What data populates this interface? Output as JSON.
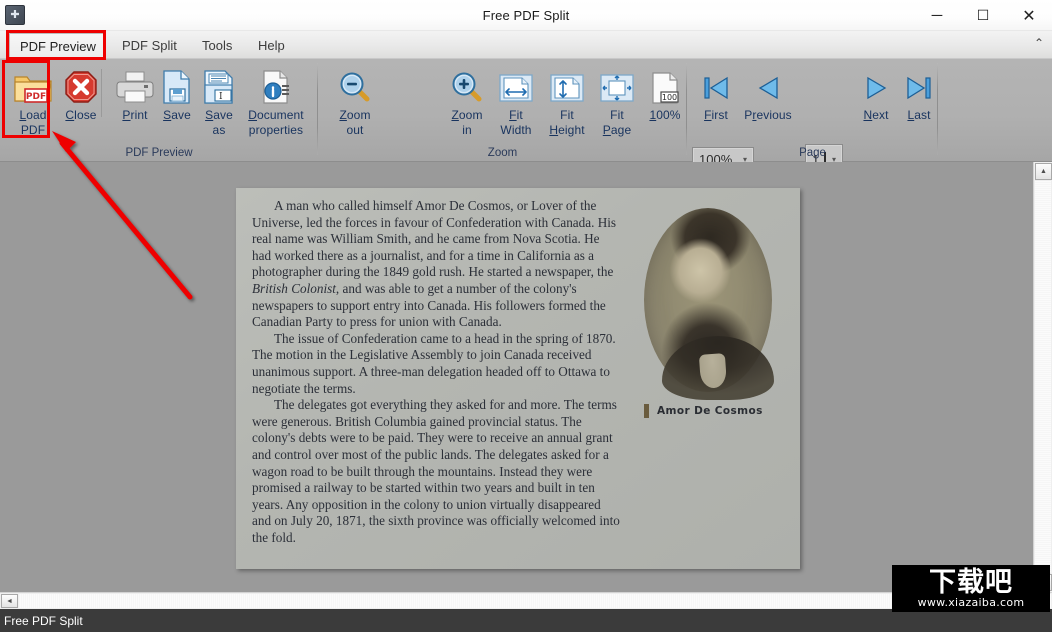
{
  "window": {
    "title": "Free PDF Split",
    "app_icon": "app-icon",
    "minimize": "─",
    "maximize": "☐",
    "close": "✕",
    "ribbon_collapse": "⌃"
  },
  "tabs": [
    {
      "label": "PDF Preview",
      "active": true,
      "highlighted": true
    },
    {
      "label": "PDF Split",
      "active": false
    },
    {
      "label": "Tools",
      "active": false
    },
    {
      "label": "Help",
      "active": false
    }
  ],
  "ribbon": {
    "groups": [
      {
        "name": "PDF Preview",
        "label": "PDF Preview",
        "buttons": [
          {
            "name": "load-pdf",
            "label_lines": [
              "Load",
              "PDF"
            ],
            "icon": "folder-pdf-icon",
            "highlighted": true
          },
          {
            "name": "close",
            "label_lines": [
              "Close"
            ],
            "icon": "close-octagon-icon"
          },
          {
            "name": "print",
            "label_lines": [
              "Print"
            ],
            "icon": "printer-icon"
          },
          {
            "name": "save",
            "label_lines": [
              "Save"
            ],
            "icon": "floppy-page-icon"
          },
          {
            "name": "save-as",
            "label_lines": [
              "Save",
              "as"
            ],
            "icon": "save-as-icon"
          },
          {
            "name": "document-properties",
            "label_lines": [
              "Document",
              "properties"
            ],
            "icon": "document-info-icon"
          }
        ]
      },
      {
        "name": "Zoom",
        "label": "Zoom",
        "buttons": [
          {
            "name": "zoom-out",
            "label_lines": [
              "Zoom",
              "out"
            ],
            "icon": "magnifier-minus-icon"
          },
          {
            "name": "zoom-in",
            "label_lines": [
              "Zoom",
              "in"
            ],
            "icon": "magnifier-plus-icon"
          },
          {
            "name": "fit-width",
            "label_lines": [
              "Fit",
              "Width"
            ],
            "icon": "fit-width-icon"
          },
          {
            "name": "fit-height",
            "label_lines": [
              "Fit",
              "Height"
            ],
            "icon": "fit-height-icon"
          },
          {
            "name": "fit-page",
            "label_lines": [
              "Fit",
              "Page"
            ],
            "icon": "fit-page-icon"
          },
          {
            "name": "zoom-100",
            "label_lines": [
              "100%"
            ],
            "icon": "page-100-icon"
          }
        ],
        "zoom_combo": {
          "value": "100%",
          "arrow": "▾"
        }
      },
      {
        "name": "Page",
        "label": "Page",
        "buttons": [
          {
            "name": "first-page",
            "label_lines": [
              "First"
            ],
            "icon": "first-page-icon"
          },
          {
            "name": "previous-page",
            "label_lines": [
              "Previous"
            ],
            "icon": "previous-page-icon"
          },
          {
            "name": "next-page",
            "label_lines": [
              "Next"
            ],
            "icon": "next-page-icon"
          },
          {
            "name": "last-page",
            "label_lines": [
              "Last"
            ],
            "icon": "last-page-icon"
          }
        ],
        "page_combo": {
          "value": "1",
          "arrow": "▾"
        }
      }
    ]
  },
  "document": {
    "paragraphs": [
      "A man who called himself Amor De Cosmos, or Lover of the Universe, led the forces in favour of Confederation with Canada. His real name was William Smith, and he came from Nova Scotia. He had worked there as a journalist, and for a time in California as a photographer during the 1849 gold rush. He started a newspaper, the ",
      "The issue of Confederation came to a head in the spring of 1870. The motion in the Legislative Assembly to join Canada received unanimous support. A three-man delegation headed off to Ottawa to negotiate the terms.",
      "The delegates got everything they asked for and more. The terms were generous. British Columbia gained provincial status. The colony's debts were to be paid. They were to receive an annual grant and control over most of the public lands. The delegates asked for a wagon road to be built through the mountains. Instead they were promised a railway to be started within two years and built in ten years. Any opposition in the colony to union virtually disappeared and on July 20, 1871, the sixth province was officially welcomed into the fold."
    ],
    "para1_italic": "British Colonist",
    "para1_tail": ", and was able to get a number of the colony's newspapers to support entry into Canada. His followers formed the Canadian Party to press for union with Canada.",
    "figure_caption": "Amor De Cosmos"
  },
  "scrollbars": {
    "v_up": "▲",
    "v_down": "▼",
    "h_left": "◄"
  },
  "status": {
    "text": "Free PDF Split"
  },
  "watermark": {
    "cn": "下载吧",
    "url": "www.xiazaiba.com"
  },
  "colors": {
    "annotation_red": "#ee0000",
    "ribbon_bg": "#b0b0b0",
    "label_blue": "#18335e",
    "status_bg": "#3b3b3b"
  }
}
